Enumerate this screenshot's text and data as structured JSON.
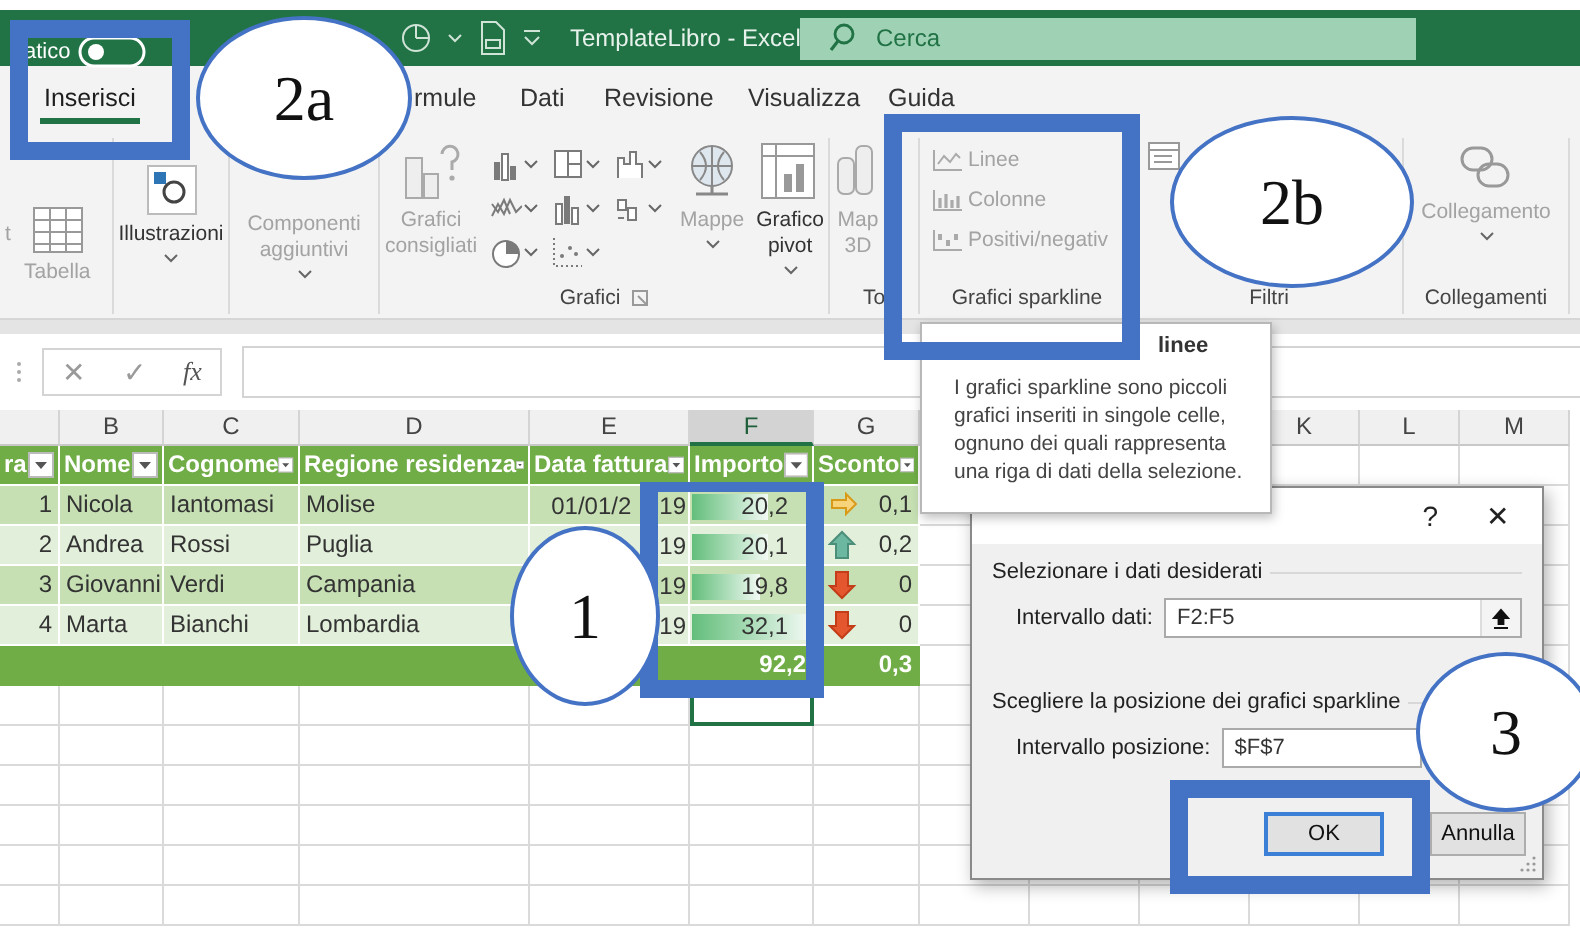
{
  "title_bar": {
    "autosave_label": "atico",
    "autosave_on": false,
    "title": "TemplateLibro  -  Excel",
    "search": {
      "placeholder": "Cerca"
    }
  },
  "ribbon": {
    "tabs": [
      {
        "label": "Inserisci",
        "selected": true
      },
      {
        "label": "rmule",
        "selected": false
      },
      {
        "label": "Dati",
        "selected": false
      },
      {
        "label": "Revisione",
        "selected": false
      },
      {
        "label": "Visualizza",
        "selected": false
      },
      {
        "label": "Guida",
        "selected": false
      }
    ],
    "groups": [
      {
        "items": [
          {
            "kind": "large",
            "label": "t",
            "disabled": true,
            "dropdown": false
          },
          {
            "kind": "large",
            "label": "Tabella",
            "disabled": true,
            "dropdown": false
          }
        ]
      },
      {
        "items": [
          {
            "kind": "large",
            "label": "Illustrazioni",
            "disabled": false,
            "dropdown": true
          }
        ]
      },
      {
        "items": [
          {
            "kind": "large",
            "label": "Componenti aggiuntivi",
            "disabled": true,
            "dropdown": true
          }
        ]
      },
      {
        "label": "Grafici",
        "launcher": true,
        "items": [
          {
            "kind": "large",
            "label": "Grafici consigliati",
            "disabled": true,
            "dropdown": false
          },
          {
            "kind": "gallery"
          },
          {
            "kind": "large",
            "label": "Mappe",
            "disabled": true,
            "dropdown": true
          },
          {
            "kind": "large",
            "label": "Grafico pivot",
            "disabled": false,
            "dropdown": true
          }
        ]
      },
      {
        "label": "To",
        "items": [
          {
            "kind": "large",
            "label": "Map 3D",
            "disabled": true,
            "dropdown": false
          }
        ]
      },
      {
        "label": "Grafici sparkline",
        "items": [
          {
            "kind": "small",
            "label": "Linee",
            "disabled": true
          },
          {
            "kind": "small",
            "label": "Colonne",
            "disabled": true
          },
          {
            "kind": "small",
            "label": "Positivi/negativ",
            "disabled": true
          }
        ]
      },
      {
        "label": "Filtri",
        "items": [
          {
            "kind": "icon"
          }
        ]
      },
      {
        "label": "Collegamenti",
        "items": [
          {
            "kind": "large",
            "label": "Collegamento",
            "disabled": true,
            "dropdown": true
          }
        ]
      }
    ]
  },
  "formula_bar": {
    "buttons": [
      "✕",
      "✓"
    ],
    "fx": "fx"
  },
  "sheet": {
    "columns": [
      {
        "kind": "blank",
        "selected": false
      },
      {
        "kind": "letter",
        "letter": "B",
        "selected": false
      },
      {
        "kind": "letter",
        "letter": "C",
        "selected": false
      },
      {
        "kind": "letter",
        "letter": "D",
        "selected": false
      },
      {
        "kind": "letter",
        "letter": "E",
        "selected": false
      },
      {
        "kind": "letter",
        "letter": "F",
        "selected": true
      },
      {
        "kind": "letter",
        "letter": "G",
        "selected": false
      },
      {
        "kind": "blank"
      },
      {
        "kind": "blank"
      },
      {
        "kind": "blank"
      },
      {
        "kind": "letter",
        "letter": "K",
        "selected": false
      },
      {
        "kind": "letter",
        "letter": "L",
        "selected": false
      },
      {
        "kind": "letter",
        "letter": "M",
        "selected": false
      }
    ],
    "headers": [
      "ra",
      "Nome",
      "Cognome",
      "Regione residenza",
      "Data fattura",
      "Importo",
      "Sconto"
    ],
    "rows": [
      {
        "n": "1",
        "nome": "Nicola",
        "cognome": "Iantomasi",
        "regione": "Molise",
        "data": [
          "01/01/2",
          "19"
        ],
        "importo": "20,2",
        "level": 0.63,
        "trend": {
          "kind": "flat"
        },
        "sconto": "0,1"
      },
      {
        "n": "2",
        "nome": "Andrea",
        "cognome": "Rossi",
        "regione": "Puglia",
        "data": [
          "19"
        ],
        "importo": "20,1",
        "level": 0.63,
        "trend": {
          "kind": "up"
        },
        "sconto": "0,2"
      },
      {
        "n": "3",
        "nome": "Giovanni",
        "cognome": "Verdi",
        "regione": "Campania",
        "data": [
          "19"
        ],
        "importo": "19,8",
        "level": 0.55,
        "trend": {
          "kind": "down"
        },
        "sconto": "0"
      },
      {
        "n": "4",
        "nome": "Marta",
        "cognome": "Bianchi",
        "regione": "Lombardia",
        "data": [
          "19"
        ],
        "importo": "32,1",
        "level": 1,
        "trend": {
          "kind": "down"
        },
        "sconto": "0"
      }
    ],
    "total": {
      "importo": "92,2",
      "sconto": "0,3"
    },
    "blank_rows": [
      {
        "selected": true
      },
      {
        "selected": false
      },
      {
        "selected": false
      },
      {
        "selected": false
      },
      {
        "selected": false
      },
      {
        "selected": false
      }
    ]
  },
  "tooltip": {
    "title": "linee",
    "text": "I grafici sparkline sono piccoli grafici inseriti in singole celle, ognuno dei quali rappresenta una riga di dati della selezione."
  },
  "dialog": {
    "title_buttons": [
      "?",
      "✕"
    ],
    "sections": [
      {
        "heading": "Selezionare i dati desiderati",
        "field_label": "Intervallo dati:",
        "value": "F2:F5",
        "picker": true
      },
      {
        "heading": "Scegliere la posizione dei grafici sparkline",
        "field_label": "Intervallo posizione:",
        "value": "$F$7",
        "picker": false
      }
    ],
    "buttons": [
      {
        "label": "OK",
        "default": true
      },
      {
        "label": "Annulla",
        "default": false
      }
    ]
  },
  "annotations": [
    {
      "label": "2a"
    },
    {
      "label": "2b"
    },
    {
      "label": "1"
    },
    {
      "label": "3"
    }
  ]
}
